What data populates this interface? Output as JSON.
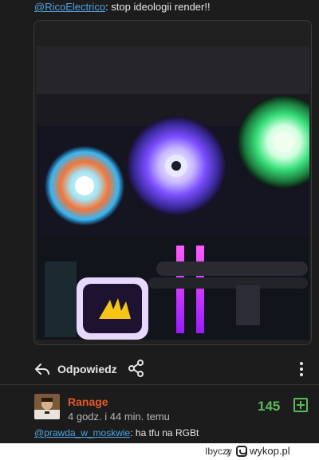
{
  "top_comment": {
    "mention": "@RicoElectrico",
    "text": ": stop ideologii render!!"
  },
  "post": {
    "media_alt": "PC RGB fans image",
    "actions": {
      "reply_label": "Odpowiedz",
      "reply_icon": "reply-arrow-icon",
      "share_icon": "share-icon",
      "more_icon": "more-vertical-icon"
    }
  },
  "comment": {
    "username": "Ranage",
    "timestamp": "4 godz. i 44 min. temu",
    "score": "145",
    "vote_icon": "plus-square-icon",
    "reply_mention": "@prawda_w_moskwie",
    "reply_text": ": ha tfu na RGBt"
  },
  "footer": {
    "author": "Ibyczy",
    "via": "z",
    "logo_text": "wykop.pl"
  },
  "colors": {
    "accent_link": "#4fa3e0",
    "username": "#e8592a",
    "score": "#5cb85c",
    "background": "#1c1c1c"
  }
}
